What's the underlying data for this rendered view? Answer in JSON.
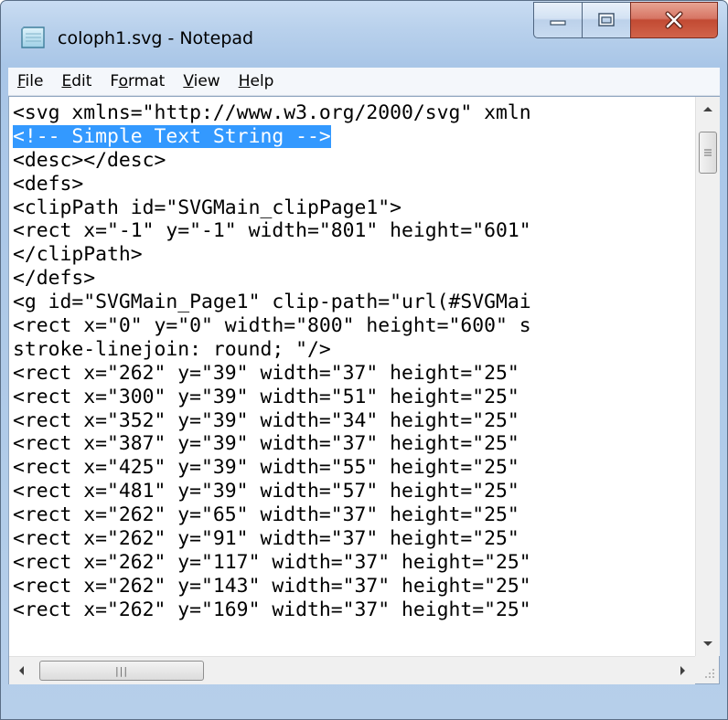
{
  "window": {
    "title": "coloph1.svg - Notepad",
    "icon": "notepad-icon",
    "caption_buttons": [
      "minimize-icon",
      "maximize-icon",
      "close-icon"
    ]
  },
  "menu": [
    {
      "label": "File",
      "mnemonic": "F",
      "rest": "ile"
    },
    {
      "label": "Edit",
      "mnemonic": "E",
      "rest": "dit"
    },
    {
      "label": "Format",
      "pre": "F",
      "mnemonic": "o",
      "rest": "rmat"
    },
    {
      "label": "View",
      "mnemonic": "V",
      "rest": "iew"
    },
    {
      "label": "Help",
      "mnemonic": "H",
      "rest": "elp"
    }
  ],
  "editor": {
    "lines": [
      "<svg xmlns=\"http://www.w3.org/2000/svg\" xmln",
      "<!-- Simple Text String -->",
      "<desc></desc>",
      "<defs>",
      "<clipPath id=\"SVGMain_clipPage1\">",
      "<rect x=\"-1\" y=\"-1\" width=\"801\" height=\"601\"",
      "</clipPath>",
      "</defs>",
      "<g id=\"SVGMain_Page1\" clip-path=\"url(#SVGMai",
      "<rect x=\"0\" y=\"0\" width=\"800\" height=\"600\" s",
      "stroke-linejoin: round; \"/>",
      "<rect x=\"262\" y=\"39\" width=\"37\" height=\"25\"",
      "<rect x=\"300\" y=\"39\" width=\"51\" height=\"25\"",
      "<rect x=\"352\" y=\"39\" width=\"34\" height=\"25\"",
      "<rect x=\"387\" y=\"39\" width=\"37\" height=\"25\"",
      "<rect x=\"425\" y=\"39\" width=\"55\" height=\"25\"",
      "<rect x=\"481\" y=\"39\" width=\"57\" height=\"25\"",
      "<rect x=\"262\" y=\"65\" width=\"37\" height=\"25\"",
      "<rect x=\"262\" y=\"91\" width=\"37\" height=\"25\"",
      "<rect x=\"262\" y=\"117\" width=\"37\" height=\"25\"",
      "<rect x=\"262\" y=\"143\" width=\"37\" height=\"25\"",
      "<rect x=\"262\" y=\"169\" width=\"37\" height=\"25\""
    ],
    "selected_line": 1
  },
  "scrollbars": {
    "vertical_thumb_grip": "grip-lines-icon",
    "horizontal_thumb_grip": "|||"
  },
  "colors": {
    "selection": "#3399ff",
    "close_button": "#c24a33"
  }
}
